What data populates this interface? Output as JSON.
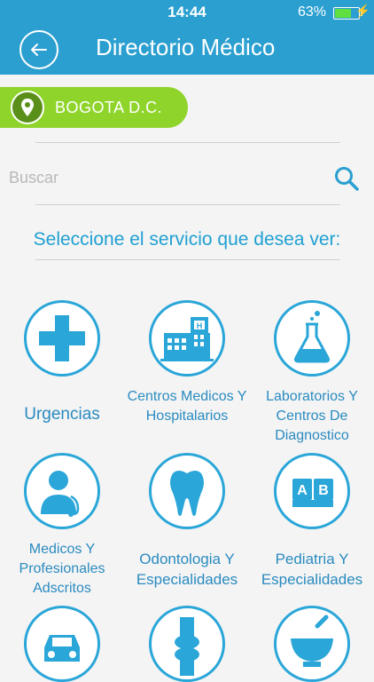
{
  "status_bar": {
    "time": "14:44",
    "battery": "63%",
    "battery_level": 0.63
  },
  "header": {
    "title": "Directorio Médico"
  },
  "location": {
    "city": "BOGOTA D.C."
  },
  "search": {
    "placeholder": "Buscar"
  },
  "prompt": "Seleccione el servicio que desea ver:",
  "services": [
    {
      "label": "Urgencias",
      "icon": "cross-icon"
    },
    {
      "label": "Centros Medicos Y Hospitalarios",
      "icon": "hospital-icon"
    },
    {
      "label": "Laboratorios Y Centros De Diagnostico",
      "icon": "flask-icon"
    },
    {
      "label": "Medicos Y Profesionales Adscritos",
      "icon": "doctor-icon"
    },
    {
      "label": "Odontologia Y Especialidades",
      "icon": "tooth-icon"
    },
    {
      "label": "Pediatria Y Especialidades",
      "icon": "abc-blocks-icon"
    },
    {
      "label": "",
      "icon": "ambulance-car-icon"
    },
    {
      "label": "",
      "icon": "knee-joint-icon"
    },
    {
      "label": "",
      "icon": "mortar-pestle-icon"
    }
  ],
  "colors": {
    "primary": "#2a9fd0",
    "location_bg": "#8fd42a",
    "icon_blue": "#2aa6d8"
  }
}
